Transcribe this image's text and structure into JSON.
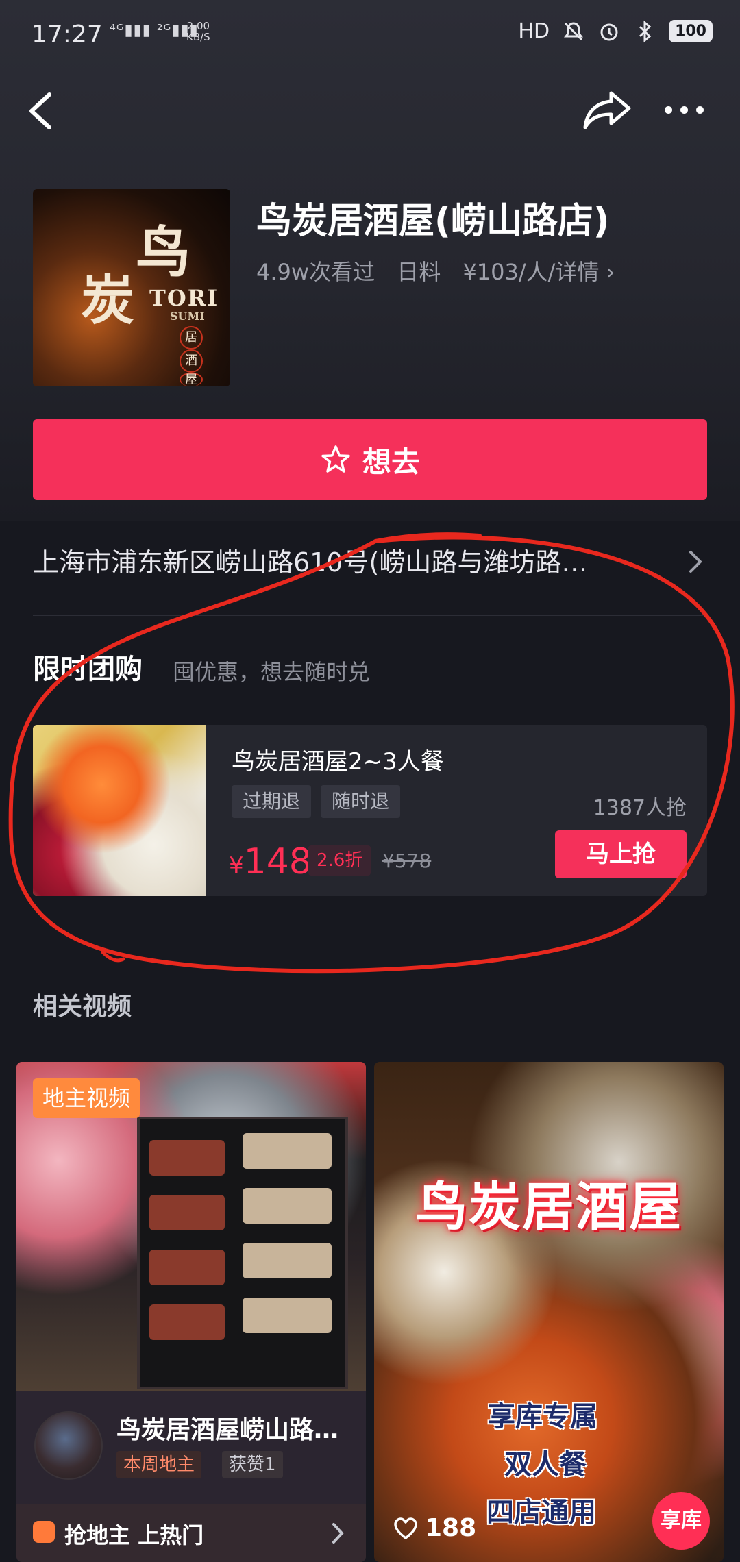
{
  "status_bar": {
    "time": "17:27",
    "network": "⁴ᴳ▮▮▮ ²ᴳ▮▮▮",
    "speed_value": "2.00",
    "speed_unit": "KB/S",
    "hd": "HD",
    "battery": "100"
  },
  "colors": {
    "accent": "#f5305a",
    "price": "#ff2f55",
    "annotation": "#e8281e",
    "badge_orange": "#ff8a3d"
  },
  "shop": {
    "logo_text_1": "鸟",
    "logo_text_2": "炭",
    "logo_text_3": "TORI",
    "logo_text_4": "SUMI",
    "logo_seal_1": "居",
    "logo_seal_2": "酒",
    "logo_seal_3": "屋",
    "name": "鸟炭居酒屋(崂山路店)",
    "views": "4.9w次看过",
    "cuisine": "日料",
    "price_detail": "¥103/人/详情 ›"
  },
  "want_button": {
    "label": "想去"
  },
  "address": "上海市浦东新区崂山路610号(崂山路与潍坊路…",
  "deal_section": {
    "title": "限时团购",
    "subtitle": "囤优惠，想去随时兑",
    "item": {
      "name": "鸟炭居酒屋2~3人餐",
      "tags": [
        "过期退",
        "随时退"
      ],
      "grab_count": "1387人抢",
      "currency": "¥",
      "price": "148",
      "discount": "2.6折",
      "original_price": "¥578",
      "button": "马上抢"
    }
  },
  "related": {
    "title": "相关视频",
    "videos": [
      {
        "badge": "地主视频",
        "title": "鸟炭居酒屋崂山路…",
        "chip": "本周地主",
        "likes": "获赞1",
        "hot_label": "抢地主 上热门"
      },
      {
        "headline": "鸟炭居酒屋",
        "line1": "享库专属",
        "line2": "双人餐",
        "line3": "四店通用",
        "likes": "188",
        "logo": "享库"
      }
    ]
  }
}
